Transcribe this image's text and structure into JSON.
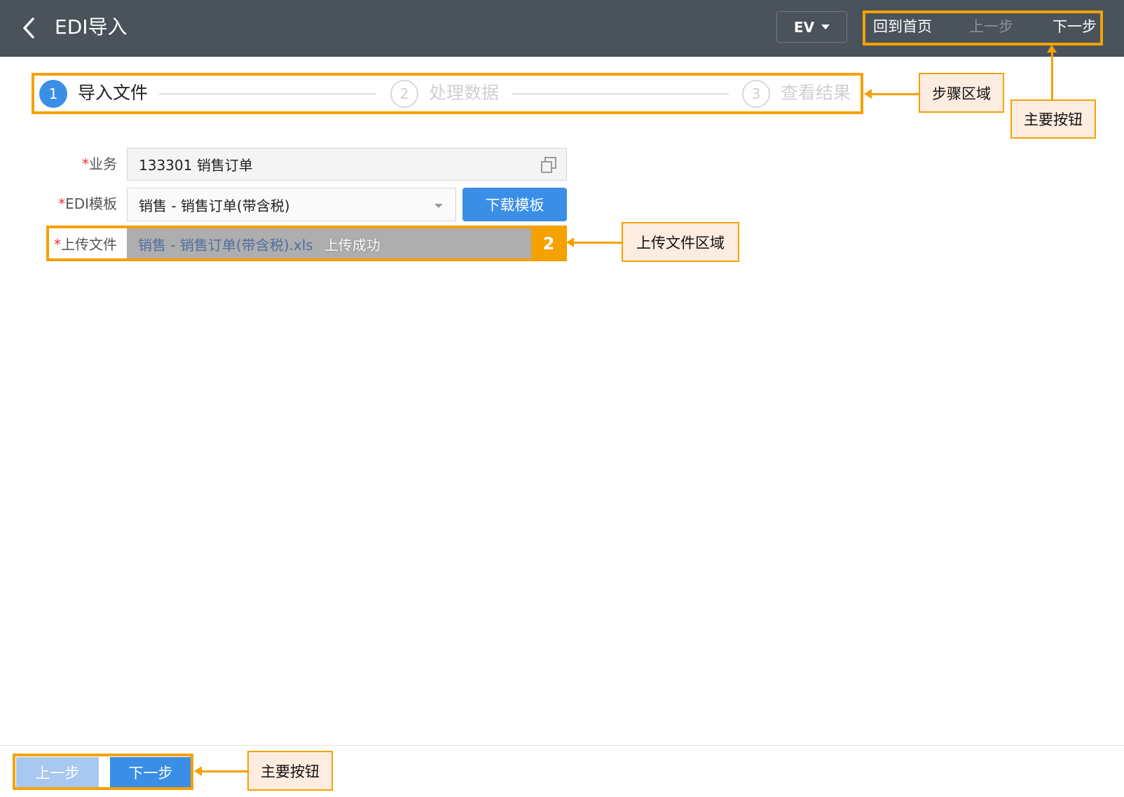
{
  "header": {
    "title": "EDI导入",
    "lang": "EV",
    "home_label": "回到首页",
    "prev_label": "上一步",
    "next_label": "下一步"
  },
  "steps": [
    {
      "num": "1",
      "label": "导入文件",
      "state": "active"
    },
    {
      "num": "2",
      "label": "处理数据",
      "state": "inactive"
    },
    {
      "num": "3",
      "label": "查看结果",
      "state": "inactive"
    }
  ],
  "form": {
    "business_label": "业务",
    "business_value": "133301 销售订单",
    "template_label": "EDI模板",
    "template_value": "销售 - 销售订单(带含税)",
    "download_label": "下载模板",
    "upload_label": "上传文件",
    "upload_file": "销售 - 销售订单(带含税).xls",
    "upload_status": "上传成功",
    "required_mark": "*"
  },
  "annotations": {
    "steps_area": "步骤区域",
    "main_buttons_top": "主要按钮",
    "upload_area": "上传文件区域",
    "upload_badge": "2",
    "main_buttons_bottom": "主要按钮"
  },
  "footer": {
    "prev_label": "上一步",
    "next_label": "下一步"
  },
  "colors": {
    "header_bg": "#4a525b",
    "accent_blue": "#3a8ee6",
    "annotation_orange": "#f5a100",
    "callout_bg": "#fdece0"
  }
}
